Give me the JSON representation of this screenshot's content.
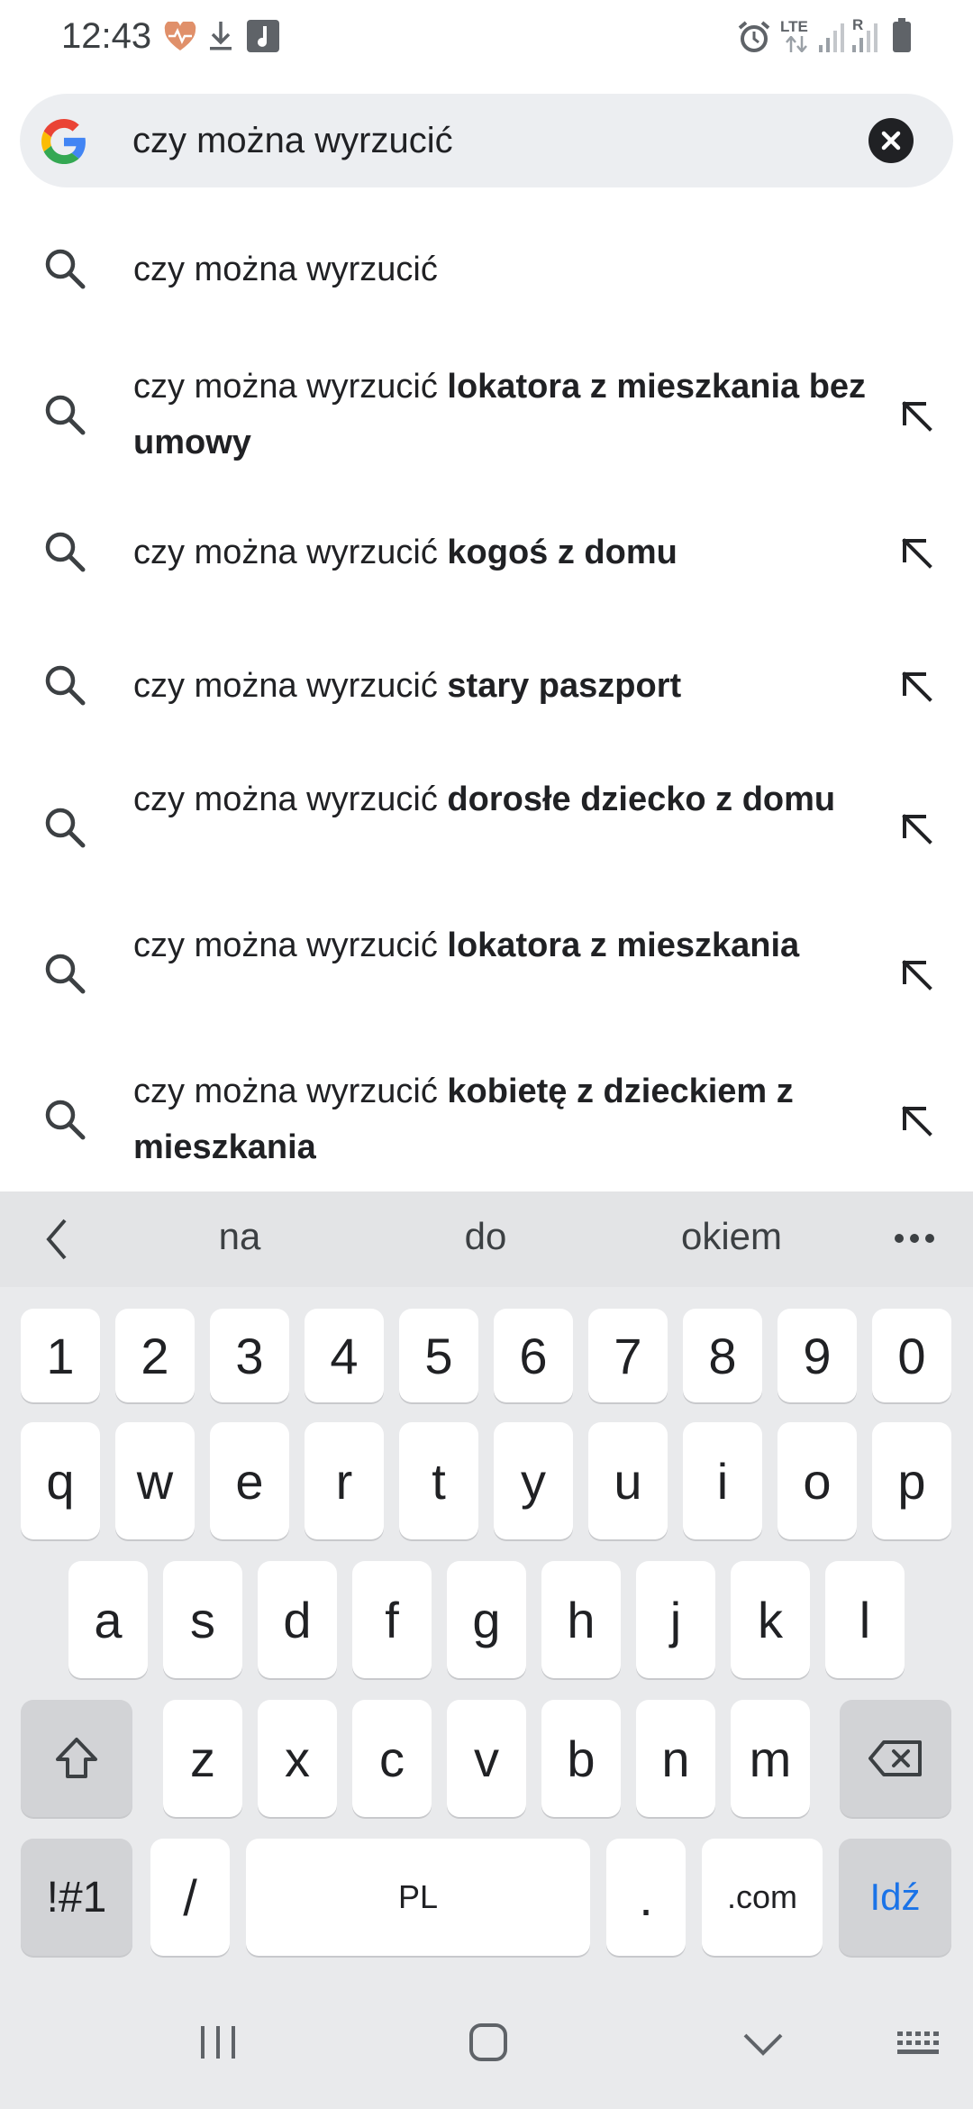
{
  "status_bar": {
    "time": "12:43",
    "left_icons": [
      "heart-rate-icon",
      "download-icon",
      "music-app-icon"
    ],
    "right_icons": [
      "alarm-icon",
      "lte-icon",
      "signal-icon",
      "signal-roaming-icon",
      "battery-icon"
    ],
    "lte_label": "LTE",
    "roaming_label": "R"
  },
  "search": {
    "query": "czy można wyrzucić",
    "logo": "google-logo-icon",
    "clear_icon": "close-icon"
  },
  "suggestions": [
    {
      "prefix": "czy można wyrzucić",
      "completion": "",
      "has_arrow": false
    },
    {
      "prefix": "czy można wyrzucić ",
      "completion": "lokatora z mieszkania bez umowy",
      "has_arrow": true
    },
    {
      "prefix": "czy można wyrzucić ",
      "completion": "kogoś z domu",
      "has_arrow": true
    },
    {
      "prefix": "czy można wyrzucić ",
      "completion": "stary paszport",
      "has_arrow": true
    },
    {
      "prefix": "czy można wyrzucić ",
      "completion": "dorosłe dziecko z domu",
      "has_arrow": true
    },
    {
      "prefix": "czy można wyrzucić ",
      "completion": "lokatora z mieszkania",
      "has_arrow": true
    },
    {
      "prefix": "czy można wyrzucić ",
      "completion": "kobietę z dzieckiem z mieszkania",
      "has_arrow": true
    }
  ],
  "keyboard": {
    "predictions": [
      "na",
      "do",
      "okiem"
    ],
    "row_numbers": [
      "1",
      "2",
      "3",
      "4",
      "5",
      "6",
      "7",
      "8",
      "9",
      "0"
    ],
    "row_q": [
      "q",
      "w",
      "e",
      "r",
      "t",
      "y",
      "u",
      "i",
      "o",
      "p"
    ],
    "row_a": [
      "a",
      "s",
      "d",
      "f",
      "g",
      "h",
      "j",
      "k",
      "l"
    ],
    "row_z": [
      "z",
      "x",
      "c",
      "v",
      "b",
      "n",
      "m"
    ],
    "symbols_key": "!#1",
    "slash_key": "/",
    "space_label": "PL",
    "period_key": ".",
    "dotcom_key": ".com",
    "go_key": "Idź"
  }
}
